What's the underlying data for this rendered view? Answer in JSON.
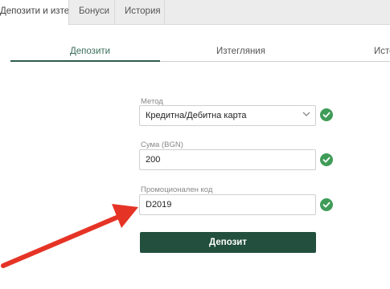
{
  "top_tabs": [
    {
      "label": "Депозити и изтегляния",
      "active": true
    },
    {
      "label": "Бонуси",
      "active": false
    },
    {
      "label": "История",
      "active": false
    }
  ],
  "sub_tabs": [
    {
      "label": "Депозити",
      "active": true
    },
    {
      "label": "Изтегляния",
      "active": false
    },
    {
      "label": "Истор",
      "active": false
    }
  ],
  "form": {
    "method": {
      "label": "Метод",
      "value": "Кредитна/Дебитна карта",
      "valid": true
    },
    "amount": {
      "label": "Сума (BGN)",
      "value": "200",
      "valid": true
    },
    "promo": {
      "label": "Промоционален код",
      "value": "D2019",
      "valid": true
    },
    "submit_label": "Депозит"
  },
  "colors": {
    "accent": "#2f5e4c",
    "button": "#224f3e",
    "check": "#3f9c58",
    "arrow": "#e53426"
  },
  "icons": {
    "check": "check-circle-icon",
    "dropdown": "chevron-down-icon",
    "annotation": "red-arrow"
  }
}
